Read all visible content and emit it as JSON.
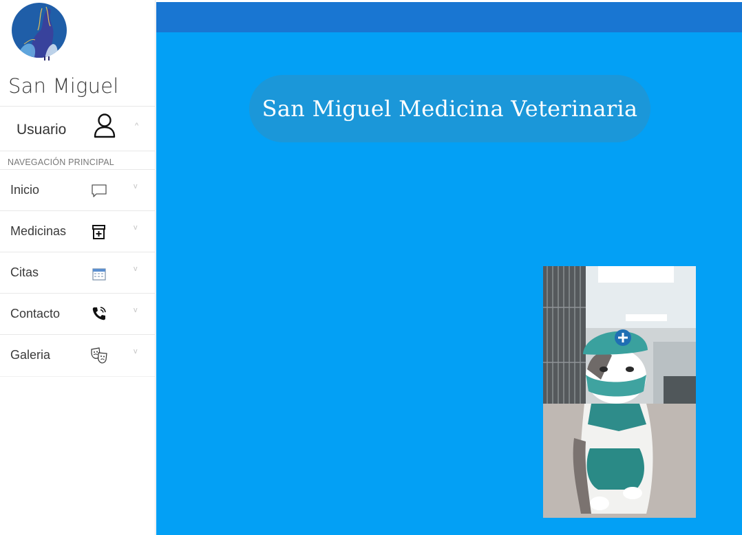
{
  "sidebar": {
    "brand": "San Miguel",
    "user": {
      "label": "Usuario",
      "icon": "user-icon"
    },
    "nav_header": "NAVEGACIÓN PRINCIPAL",
    "items": [
      {
        "label": "Inicio",
        "icon": "chat-icon"
      },
      {
        "label": "Medicinas",
        "icon": "medicine-box-icon"
      },
      {
        "label": "Citas",
        "icon": "calendar-icon"
      },
      {
        "label": "Contacto",
        "icon": "phone-icon"
      },
      {
        "label": "Galeria",
        "icon": "theater-masks-icon"
      }
    ]
  },
  "main": {
    "title": "San Miguel Medicina Veterinaria",
    "photo": "cat-veterinarian-photo"
  },
  "colors": {
    "topbar": "#1976d2",
    "main_bg": "#03a0f5",
    "title_pill": "#1b97d9",
    "logo_bg": "#1f5ea8"
  }
}
